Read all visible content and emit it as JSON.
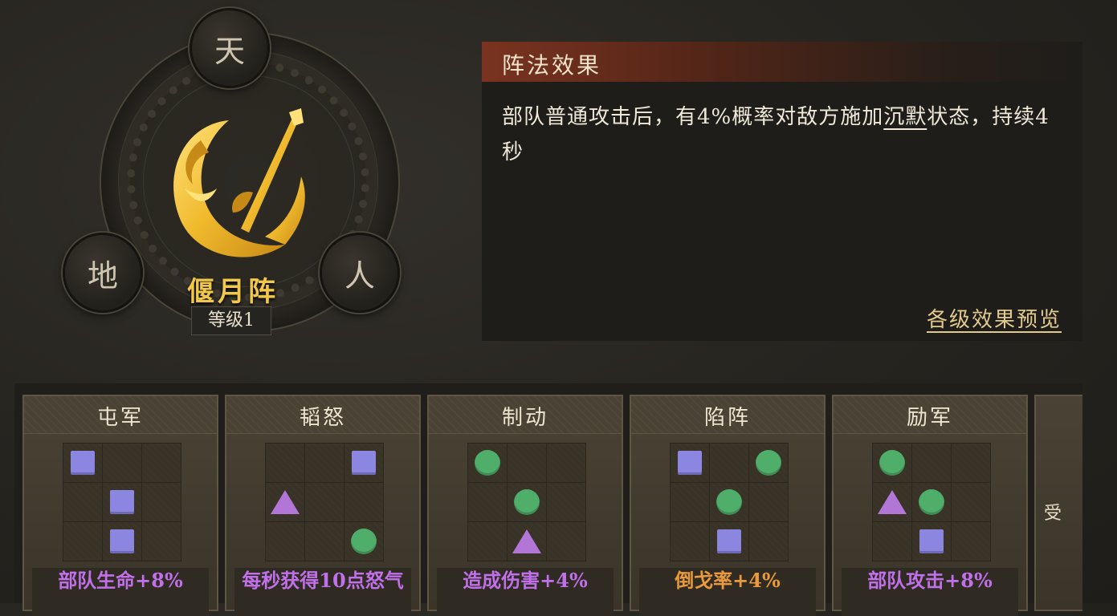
{
  "formation": {
    "name": "偃月阵",
    "level": "等级1",
    "nodes": {
      "top": "天",
      "left": "地",
      "right": "人"
    },
    "emblem_icon": "crescent-moon-blade-icon"
  },
  "effect_panel": {
    "title": "阵法效果",
    "description_prefix": "部队普通攻击后，有4%概率对敌方施加",
    "keyword": "沉默",
    "description_suffix": "状态，持续4秒",
    "preview_link": "各级效果预览"
  },
  "cards": [
    {
      "title": "屯军",
      "grid": [
        [
          "square",
          "",
          ""
        ],
        [
          "",
          "square",
          ""
        ],
        [
          "",
          "square",
          ""
        ]
      ],
      "effect": "部队生命+8%",
      "effect_color": "#c070e8"
    },
    {
      "title": "韬怒",
      "grid": [
        [
          "",
          "",
          "square"
        ],
        [
          "triangle",
          "",
          ""
        ],
        [
          "",
          "",
          "circle"
        ]
      ],
      "effect": "每秒获得10点怒气",
      "effect_color": "#c070e8"
    },
    {
      "title": "制动",
      "grid": [
        [
          "circle",
          "",
          ""
        ],
        [
          "",
          "circle",
          ""
        ],
        [
          "",
          "triangle",
          ""
        ]
      ],
      "effect": "造成伤害+4%",
      "effect_color": "#c070e8"
    },
    {
      "title": "陷阵",
      "grid": [
        [
          "square",
          "",
          "circle"
        ],
        [
          "",
          "circle",
          ""
        ],
        [
          "",
          "square",
          ""
        ]
      ],
      "effect": "倒戈率+4%",
      "effect_color": "#e89a3c"
    },
    {
      "title": "励军",
      "grid": [
        [
          "circle",
          "",
          ""
        ],
        [
          "triangle",
          "circle",
          ""
        ],
        [
          "",
          "square",
          ""
        ]
      ],
      "effect": "部队攻击+8%",
      "effect_color": "#c070e8"
    }
  ],
  "partial_card_text": "受",
  "shape_colors": {
    "square": "#8b86e0",
    "circle": "#4fae6a",
    "triangle": "#b276d6"
  }
}
